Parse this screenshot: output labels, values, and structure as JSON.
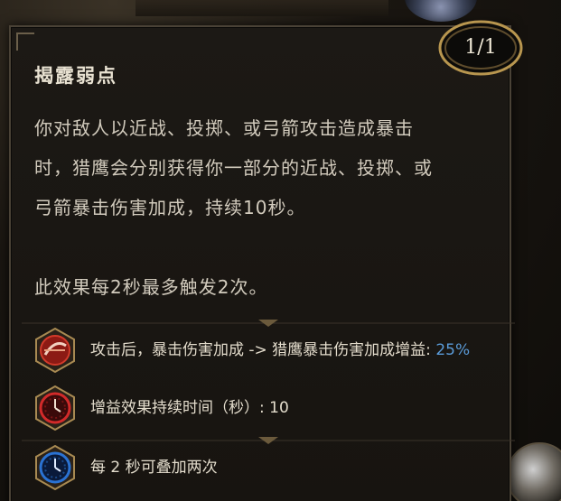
{
  "tooltip": {
    "title": "揭露弱点",
    "count_badge": "1/1",
    "description": [
      "你对敌人以近战、投掷、或弓箭攻击造成暴击时，猎鹰会分别获得你一部分的近战、投掷、或弓箭暴击伤害加成，持续10秒。",
      "此效果每2秒最多触发2次。"
    ],
    "description_lines": [
      "你对敌人以近战、投掷、或弓箭攻击造成暴击",
      "时，猎鹰会分别获得你一部分的近战、投掷、或",
      "弓箭暴击伤害加成，持续10秒。"
    ],
    "description_para2": "此效果每2秒最多触发2次。",
    "effects": [
      {
        "icon": "critical-slash-icon",
        "label": "攻击后，暴击伤害加成 -> 猎鹰暴击伤害加成增益: ",
        "value": "25%",
        "icon_color": "#c0281e"
      },
      {
        "icon": "red-clock-icon",
        "label": "增益效果持续时间（秒）: 10",
        "icon_color": "#b01a1a"
      },
      {
        "icon": "blue-clock-icon",
        "label": "每 2 秒可叠加两次",
        "icon_color": "#1f5fb8"
      }
    ],
    "colors": {
      "highlight": "#5a9bd8",
      "border": "#4a4236",
      "gold": "#b8964f"
    }
  }
}
